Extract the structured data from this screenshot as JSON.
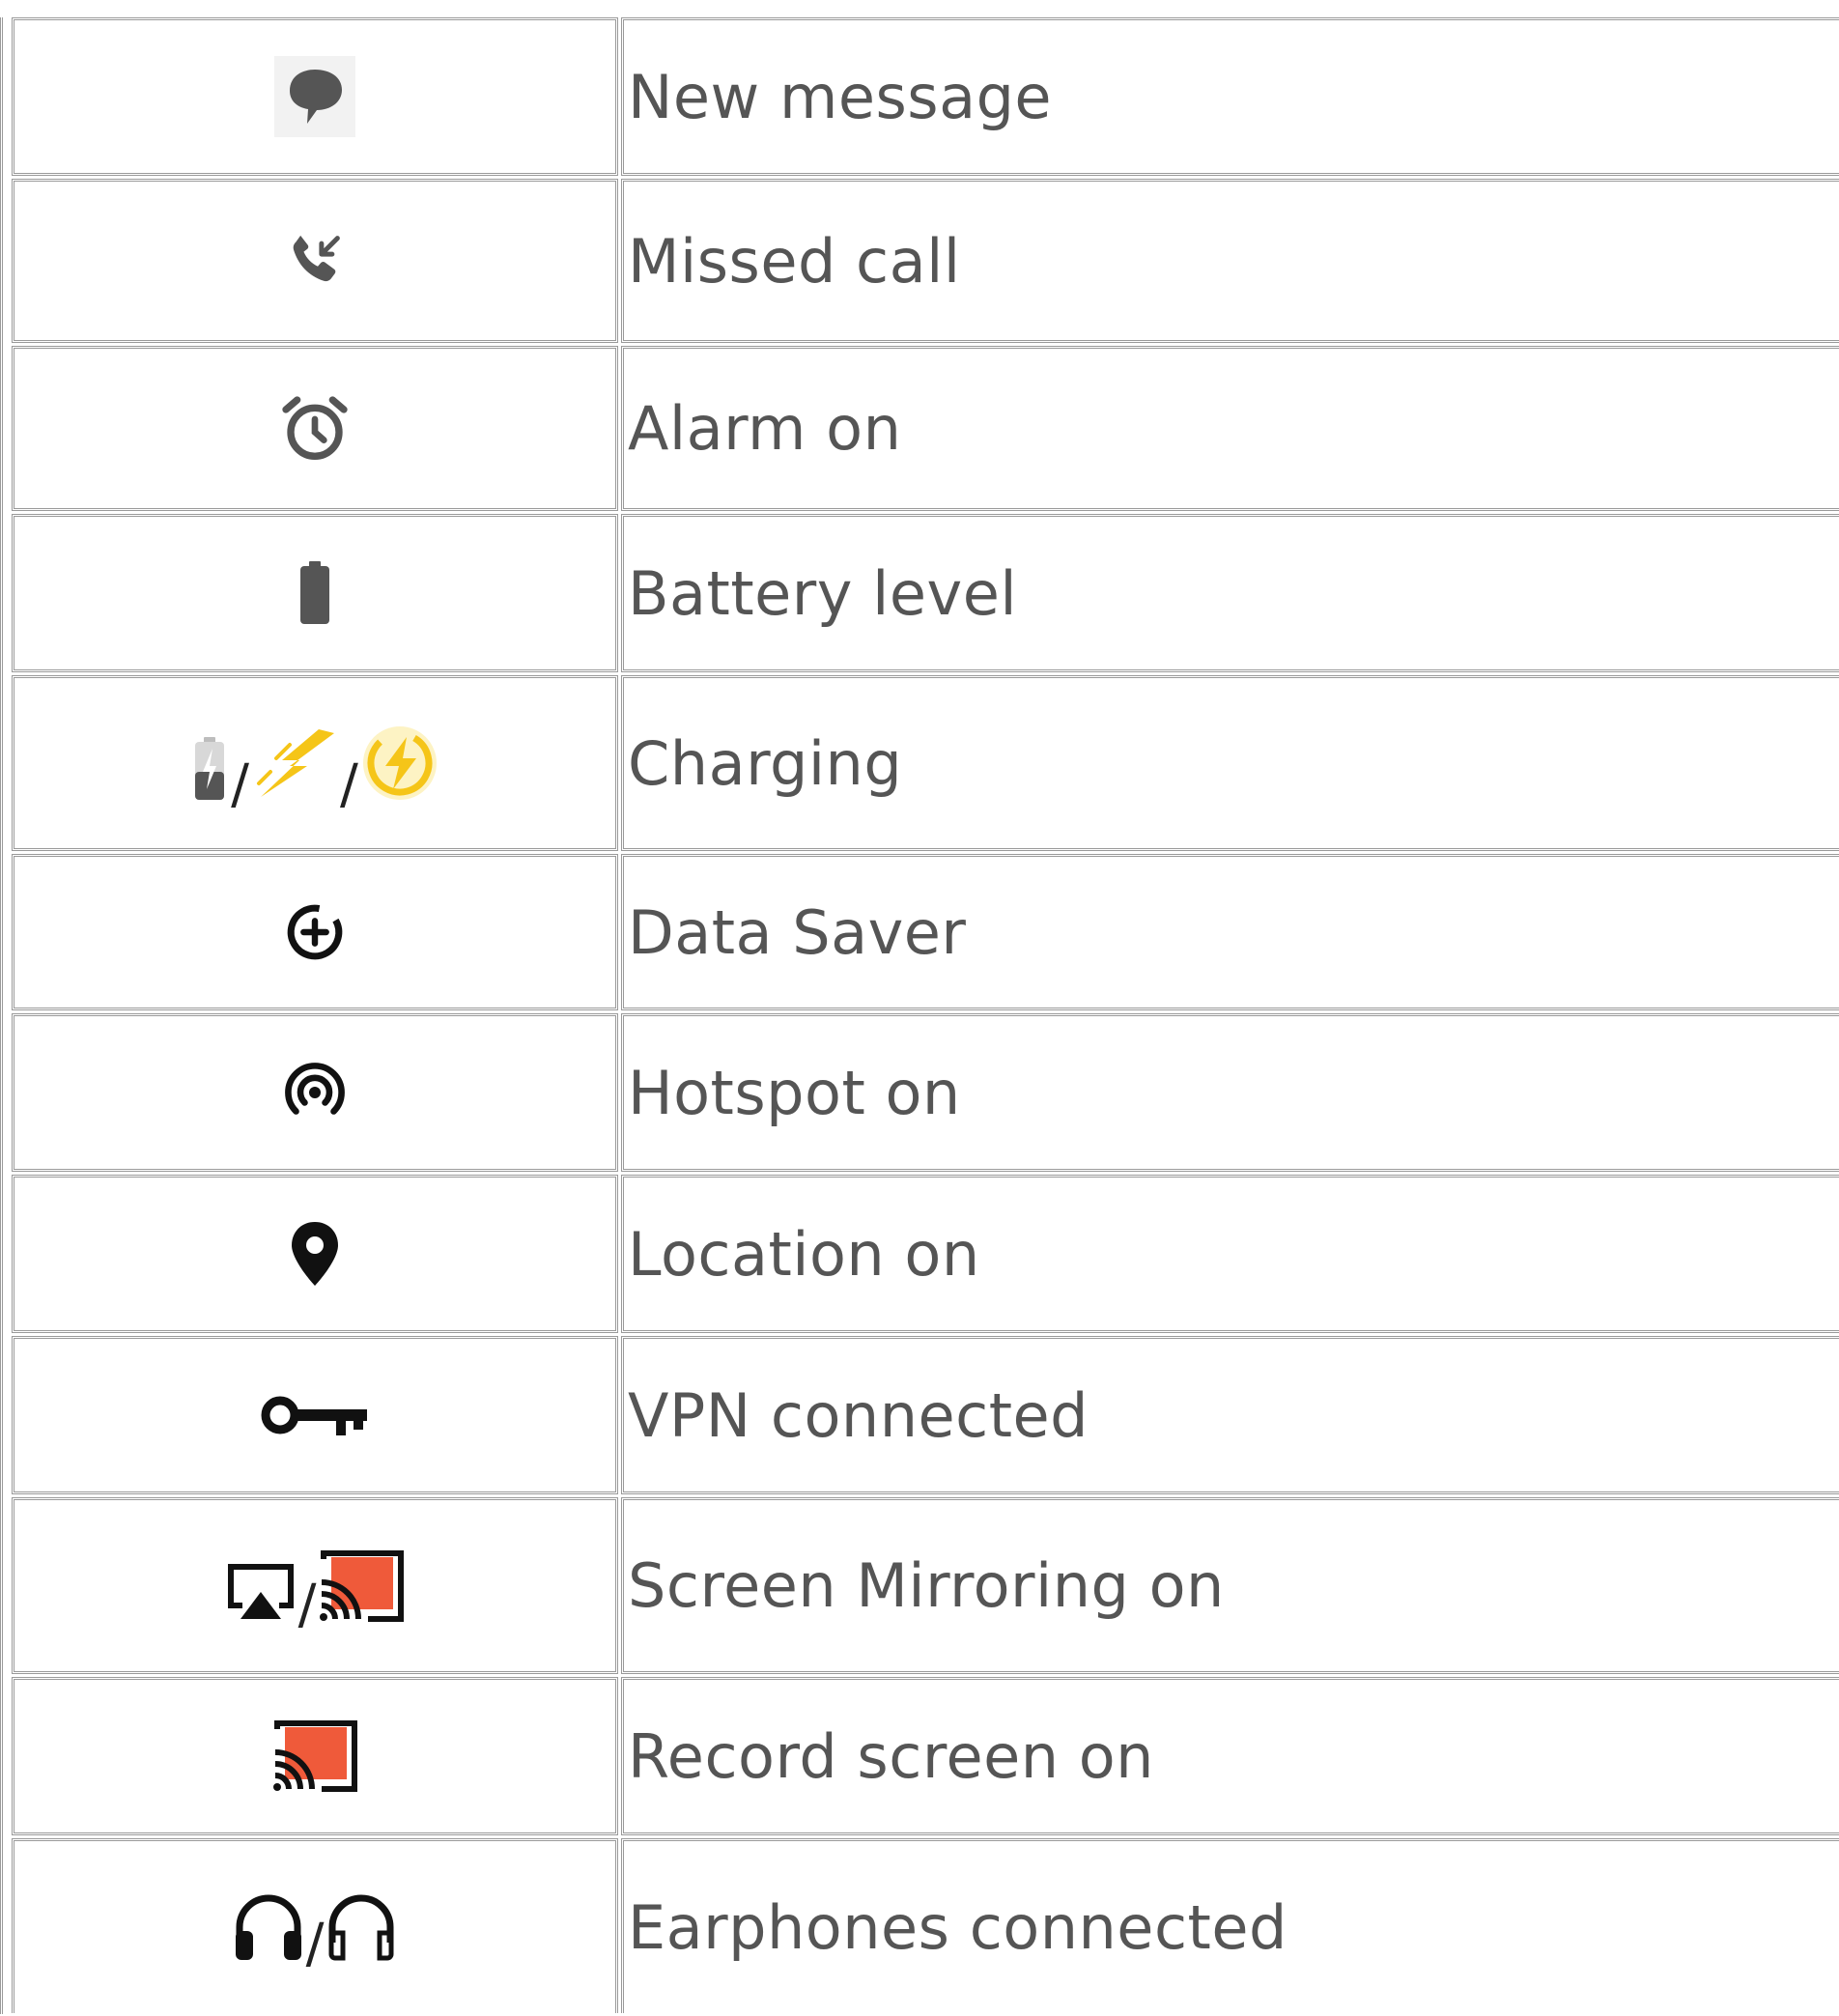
{
  "rows": [
    {
      "icon": "message-bubble-icon",
      "label": "New message"
    },
    {
      "icon": "missed-call-icon",
      "label": "Missed call"
    },
    {
      "icon": "alarm-clock-icon",
      "label": "Alarm on"
    },
    {
      "icon": "battery-icon",
      "label": "Battery level"
    },
    {
      "icon": "charging-icons",
      "label": "Charging",
      "slash": "/"
    },
    {
      "icon": "data-saver-icon",
      "label": "Data Saver"
    },
    {
      "icon": "hotspot-icon",
      "label": "Hotspot on"
    },
    {
      "icon": "location-pin-icon",
      "label": "Location on"
    },
    {
      "icon": "vpn-key-icon",
      "label": "VPN connected"
    },
    {
      "icon": "screen-mirroring-icons",
      "label": "Screen Mirroring on",
      "slash": "/"
    },
    {
      "icon": "cast-icon",
      "label": "Record screen on"
    },
    {
      "icon": "headphones-icons",
      "label": "Earphones connected",
      "slash": "/"
    }
  ],
  "colors": {
    "border": "#9a9a9a",
    "text": "#555555",
    "icon_gray": "#555555",
    "icon_black": "#111111",
    "charging_yellow": "#f5c518",
    "cast_orange": "#ef5a3a"
  }
}
